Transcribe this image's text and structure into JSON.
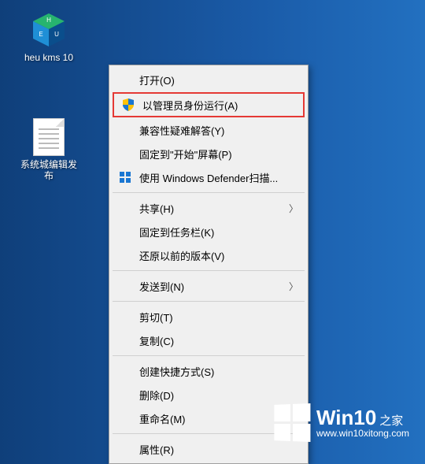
{
  "desktop": {
    "icons": [
      {
        "label": "heu kms 10"
      },
      {
        "label": "系统城编辑发布"
      }
    ]
  },
  "context_menu": {
    "open": "打开(O)",
    "run_as_admin": "以管理员身份运行(A)",
    "troubleshoot_compat": "兼容性疑难解答(Y)",
    "pin_to_start": "固定到\"开始\"屏幕(P)",
    "defender_scan": "使用 Windows Defender扫描...",
    "share": "共享(H)",
    "pin_to_taskbar": "固定到任务栏(K)",
    "restore_previous": "还原以前的版本(V)",
    "send_to": "发送到(N)",
    "cut": "剪切(T)",
    "copy": "复制(C)",
    "create_shortcut": "创建快捷方式(S)",
    "delete": "删除(D)",
    "rename": "重命名(M)",
    "properties": "属性(R)"
  },
  "watermark": {
    "title": "Win10",
    "suffix": "之家",
    "url": "www.win10xitong.com"
  }
}
